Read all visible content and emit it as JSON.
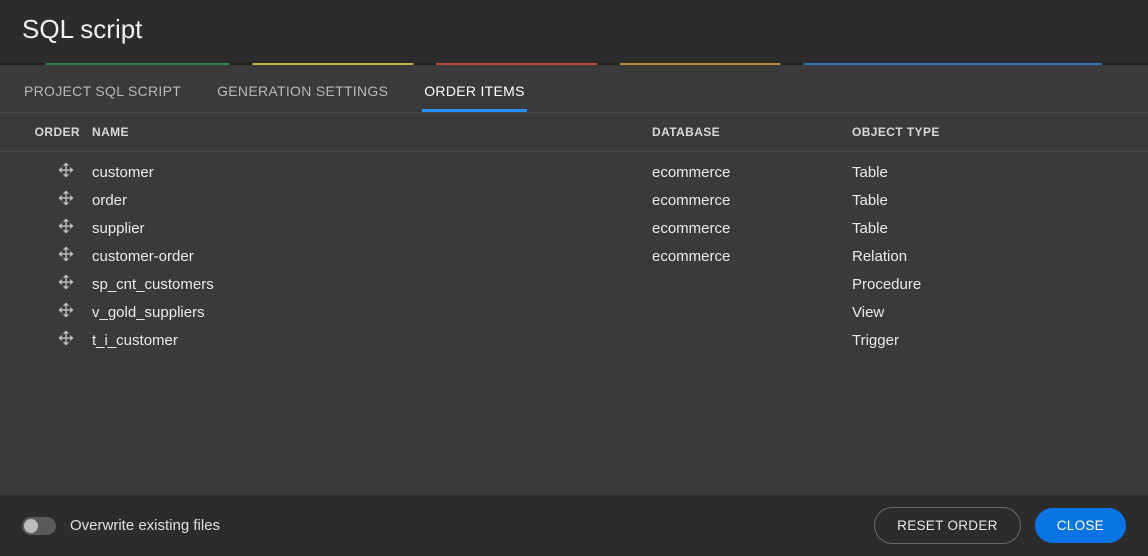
{
  "title": "SQL script",
  "tabs": [
    {
      "label": "PROJECT SQL SCRIPT",
      "active": false
    },
    {
      "label": "GENERATION SETTINGS",
      "active": false
    },
    {
      "label": "ORDER ITEMS",
      "active": true
    }
  ],
  "columns": {
    "order": "ORDER",
    "name": "NAME",
    "database": "DATABASE",
    "type": "OBJECT TYPE"
  },
  "rows": [
    {
      "name": "customer",
      "database": "ecommerce",
      "type": "Table"
    },
    {
      "name": "order",
      "database": "ecommerce",
      "type": "Table"
    },
    {
      "name": "supplier",
      "database": "ecommerce",
      "type": "Table"
    },
    {
      "name": "customer-order",
      "database": "ecommerce",
      "type": "Relation"
    },
    {
      "name": "sp_cnt_customers",
      "database": "",
      "type": "Procedure"
    },
    {
      "name": "v_gold_suppliers",
      "database": "",
      "type": "View"
    },
    {
      "name": "t_i_customer",
      "database": "",
      "type": "Trigger"
    }
  ],
  "footer": {
    "overwrite_label": "Overwrite existing files",
    "overwrite_on": false,
    "reset_label": "RESET ORDER",
    "close_label": "CLOSE"
  }
}
